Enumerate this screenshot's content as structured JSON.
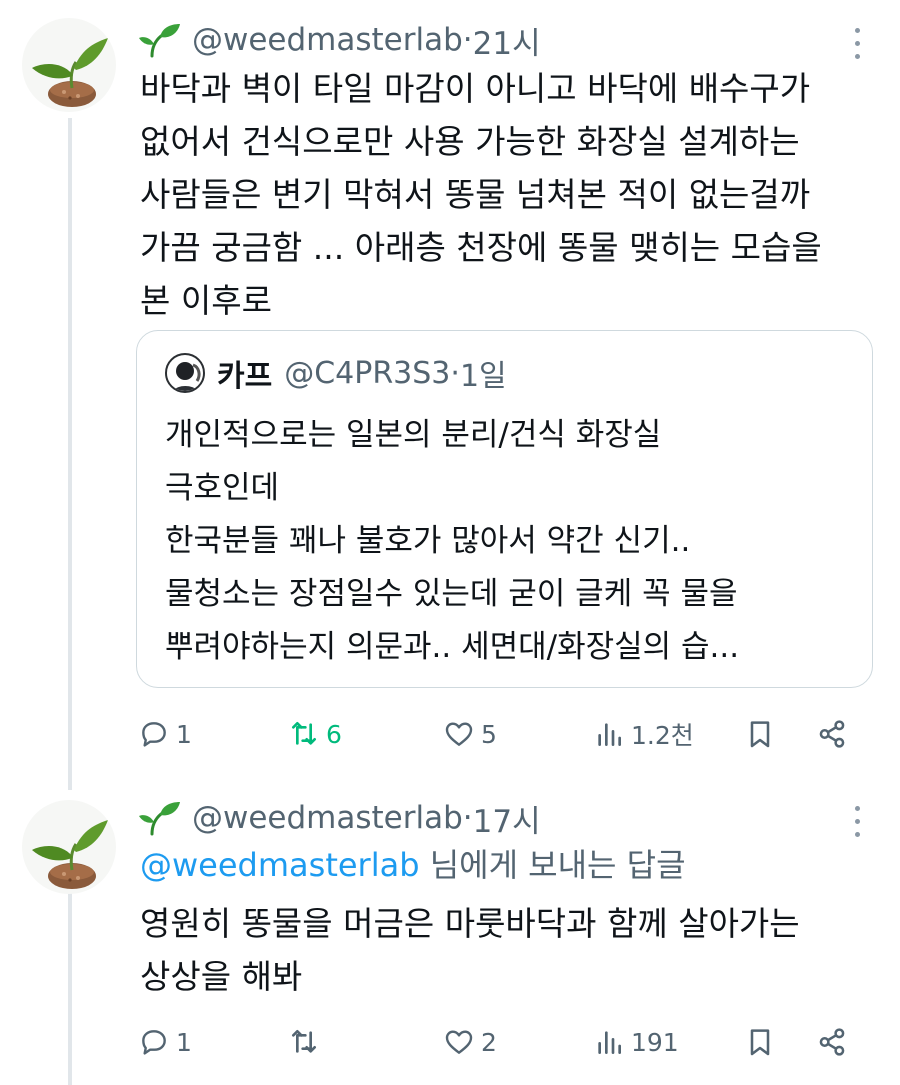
{
  "tweets": [
    {
      "handle": "@weedmasterlab",
      "separator": " · ",
      "time": "21시",
      "body_lines": [
        "바닥과 벽이 타일 마감이 아니고 바닥에 배수구가",
        "없어서 건식으로만 사용 가능한 화장실 설계하는",
        "사람들은 변기 막혀서 똥물 넘쳐본 적이 없는걸까",
        "가끔 궁금함 ... 아래층 천장에 똥물 맺히는 모습을",
        "본 이후로"
      ],
      "quote": {
        "name": "카프",
        "handle": "@C4PR3S3",
        "separator": " · ",
        "time": "1일",
        "lines": [
          "개인적으로는 일본의 분리/건식 화장실",
          "극호인데",
          "한국분들 꽤나 불호가 많아서 약간 신기..",
          "물청소는 장점일수 있는데 굳이 글케 꼭 물을",
          "뿌려야하는지 의문과.. 세면대/화장실의 습..."
        ]
      },
      "stats": {
        "replies": "1",
        "retweets": "6",
        "likes": "5",
        "views": "1.2천"
      },
      "retweet_color": "#00ba7c"
    },
    {
      "handle": "@weedmasterlab",
      "separator": " · ",
      "time": "17시",
      "reply_to": "@weedmasterlab",
      "reply_suffix": " 님에게 보내는 답글",
      "body_lines": [
        "영원히 똥물을 머금은 마룻바닥과 함께 살아가는",
        "상상을 해봐"
      ],
      "stats": {
        "replies": "1",
        "retweets": "",
        "likes": "2",
        "views": "191"
      }
    }
  ],
  "icons": {
    "sprout": "sprout-icon",
    "more": "more-dots-icon",
    "reply": "reply-icon",
    "retweet": "retweet-icon",
    "like": "heart-icon",
    "views": "views-bar-icon",
    "bookmark": "bookmark-icon",
    "share": "share-icon"
  },
  "colors": {
    "link": "#1d9bf0",
    "muted": "#536471",
    "retweet_active": "#00ba7c"
  }
}
